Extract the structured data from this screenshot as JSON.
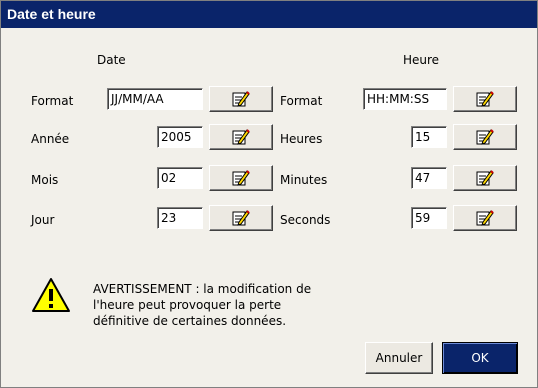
{
  "window": {
    "title": "Date et heure"
  },
  "date": {
    "heading": "Date",
    "rows": [
      {
        "label": "Format",
        "value": "JJ/MM/AA"
      },
      {
        "label": "Année",
        "value": "2005"
      },
      {
        "label": "Mois",
        "value": "02"
      },
      {
        "label": "Jour",
        "value": "23"
      }
    ]
  },
  "time": {
    "heading": "Heure",
    "rows": [
      {
        "label": "Format",
        "value": "HH:MM:SS"
      },
      {
        "label": "Heures",
        "value": "15"
      },
      {
        "label": "Minutes",
        "value": "47"
      },
      {
        "label": "Seconds",
        "value": "59"
      }
    ]
  },
  "warning": {
    "icon": "warning-icon",
    "lines": [
      "AVERTISSEMENT : la modification de",
      "l'heure peut provoquer la perte",
      "définitive de certaines données."
    ]
  },
  "buttons": {
    "cancel": "Annuler",
    "ok": "OK"
  },
  "edit_icon": "edit-icon",
  "colors": {
    "titlebar": "#0a246a",
    "warning_yellow": "#ffff00"
  }
}
